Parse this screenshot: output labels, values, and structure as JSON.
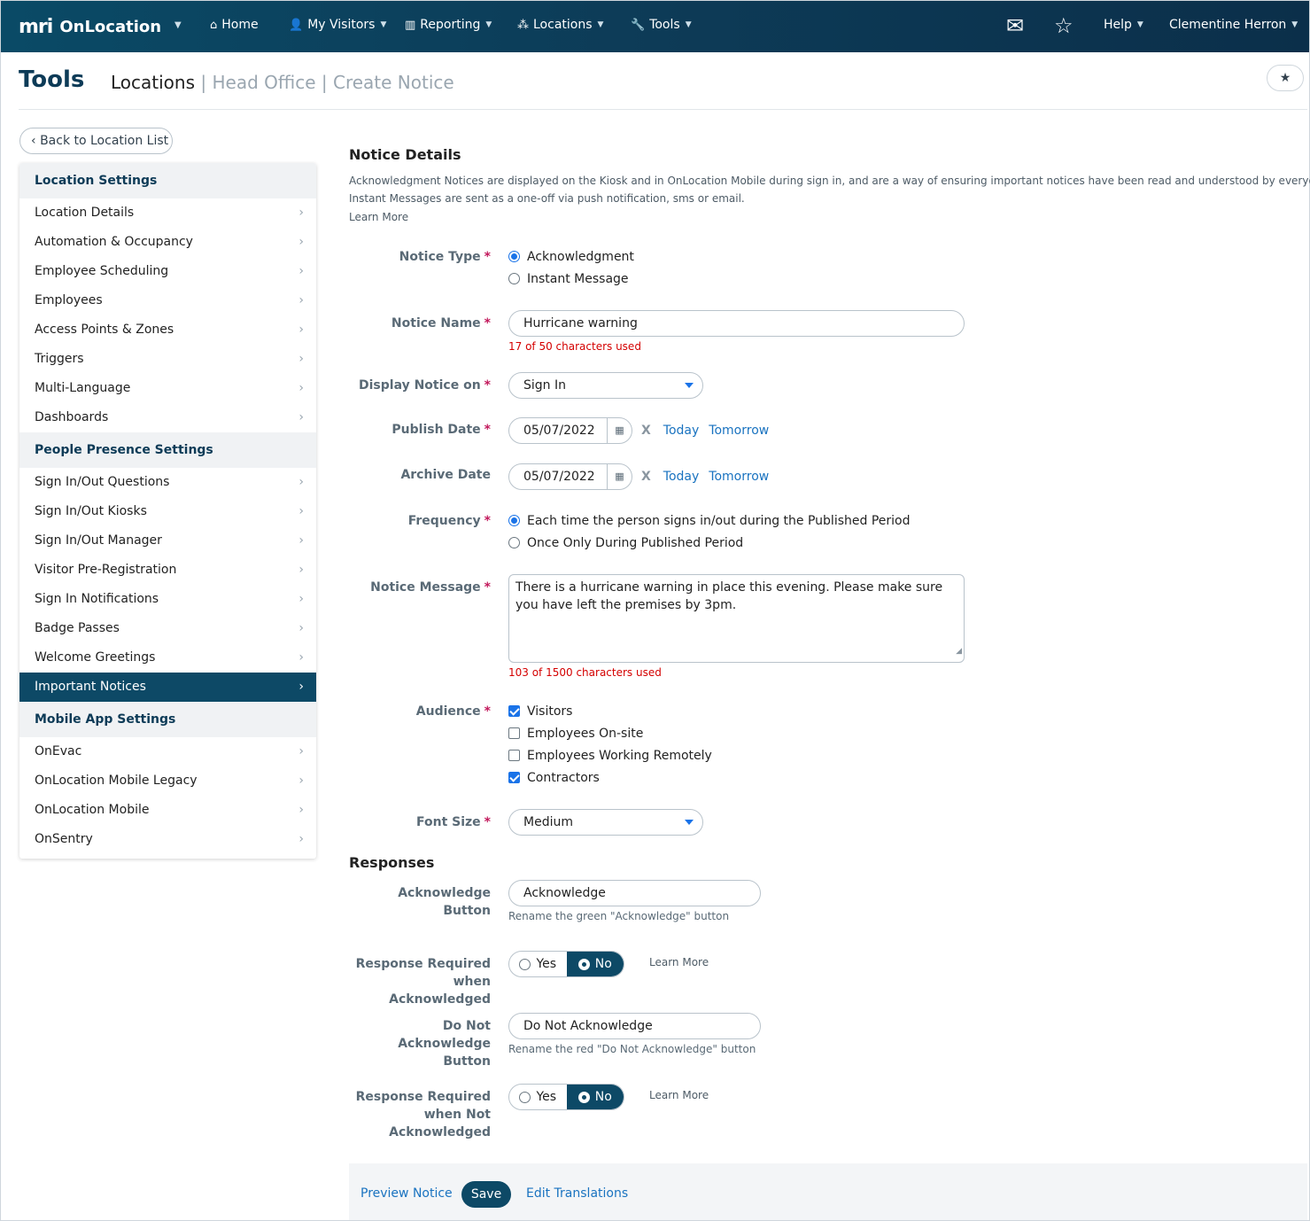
{
  "app": {
    "logo_mark": "mri",
    "name": "OnLocation"
  },
  "topnav": {
    "home": "Home",
    "my_visitors": "My Visitors",
    "reporting": "Reporting",
    "locations": "Locations",
    "tools": "Tools",
    "help": "Help",
    "user": "Clementine Herron"
  },
  "header": {
    "title": "Tools",
    "crumb_current": "Locations",
    "crumb_sep": "|",
    "crumb_2": "Head Office",
    "crumb_3": "Create Notice"
  },
  "back_label": "Back to Location List",
  "sidebar": {
    "sections": [
      {
        "title": "Location Settings",
        "items": [
          "Location Details",
          "Automation & Occupancy",
          "Employee Scheduling",
          "Employees",
          "Access Points & Zones",
          "Triggers",
          "Multi-Language",
          "Dashboards"
        ]
      },
      {
        "title": "People Presence Settings",
        "items": [
          "Sign In/Out Questions",
          "Sign In/Out Kiosks",
          "Sign In/Out Manager",
          "Visitor Pre-Registration",
          "Sign In Notifications",
          "Badge Passes",
          "Welcome Greetings",
          "Important Notices"
        ]
      },
      {
        "title": "Mobile App Settings",
        "items": [
          "OnEvac",
          "OnLocation Mobile Legacy",
          "OnLocation Mobile",
          "OnSentry"
        ]
      }
    ],
    "active_item": "Important Notices"
  },
  "notice": {
    "section_title": "Notice Details",
    "desc_line1": "Acknowledgment Notices are displayed on the Kiosk and in OnLocation Mobile during sign in, and are a way of ensuring important notices have been read and understood by everyone on-site.",
    "desc_line2": "Instant Messages are sent as a one-off via push notification, sms or email.",
    "learn_more": "Learn More",
    "type_label": "Notice Type",
    "type_options": [
      "Acknowledgment",
      "Instant Message"
    ],
    "name_label": "Notice Name",
    "name_value": "Hurricane warning",
    "name_count": "17 of 50 characters used",
    "display_label": "Display Notice on",
    "display_value": "Sign In",
    "publish_label": "Publish Date",
    "publish_value": "05/07/2022",
    "archive_label": "Archive Date",
    "archive_value": "05/07/2022",
    "clear": "X",
    "today": "Today",
    "tomorrow": "Tomorrow",
    "frequency_label": "Frequency",
    "frequency_options": [
      "Each time the person signs in/out during the Published Period",
      "Once Only During Published Period"
    ],
    "message_label": "Notice Message",
    "message_value": "There is a hurricane warning in place this evening. Please make sure you have left the premises by 3pm.",
    "message_count": "103 of 1500 characters used",
    "audience_label": "Audience",
    "audience_options": [
      "Visitors",
      "Employees On-site",
      "Employees Working Remotely",
      "Contractors"
    ],
    "font_label": "Font Size",
    "font_value": "Medium",
    "required_mark": "*"
  },
  "responses": {
    "title": "Responses",
    "ack_label": "Acknowledge Button",
    "ack_value": "Acknowledge",
    "ack_hint": "Rename the green \"Acknowledge\" button",
    "resp_ack_label_1": "Response Required",
    "resp_ack_label_2": "when Acknowledged",
    "yes": "Yes",
    "no": "No",
    "learn_more": "Learn More",
    "nack_label_1": "Do Not Acknowledge",
    "nack_label_2": "Button",
    "nack_value": "Do Not Acknowledge",
    "nack_hint": "Rename the red \"Do Not Acknowledge\" button",
    "resp_nack_label_1": "Response Required",
    "resp_nack_label_2": "when Not",
    "resp_nack_label_3": "Acknowledged"
  },
  "footer": {
    "preview": "Preview Notice",
    "save": "Save",
    "translations": "Edit Translations"
  },
  "icons": {
    "home": "home-icon",
    "visitors": "person-icon",
    "reporting": "bar-chart-icon",
    "locations": "network-icon",
    "tools": "wrench-icon",
    "mail": "mail-icon",
    "star": "star-icon",
    "calendar": "calendar-icon"
  },
  "colors": {
    "nav_bg": "#0d3b57",
    "accent": "#0d4966",
    "required": "#c2185b",
    "link": "#1a73c0",
    "counter": "#d40000"
  }
}
